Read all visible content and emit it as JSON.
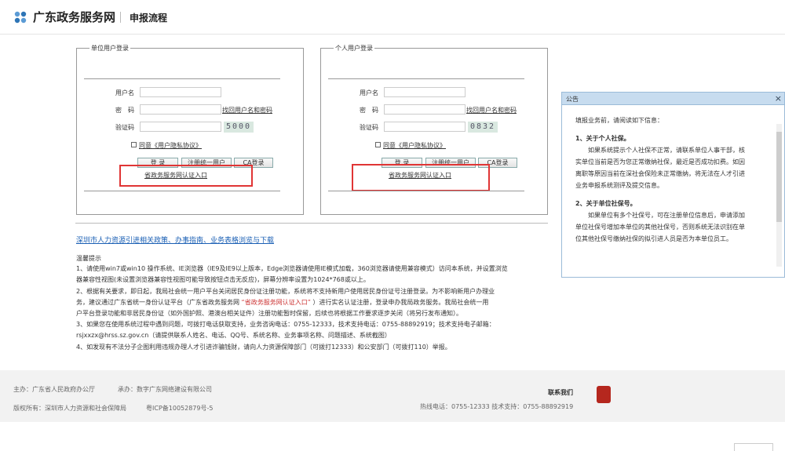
{
  "header": {
    "site_name": "广东政务服务网",
    "page_title": "申报流程"
  },
  "unit_login": {
    "legend": "单位用户登录",
    "username_label": "用户名",
    "password_label": "密　码",
    "forgot_link": "找回用户名和密码",
    "captcha_label": "验证码",
    "captcha_text": "5000",
    "agree_text": "同意《用户隐私协议》",
    "login_button": "登 录",
    "register_button": "注册统一用户",
    "ca_button": "CA登录",
    "gov_auth_link": "省政务服务网认证入口"
  },
  "personal_login": {
    "legend": "个人用户登录",
    "username_label": "用户名",
    "password_label": "密　码",
    "forgot_link": "找回用户名和密码",
    "captcha_label": "验证码",
    "captcha_text": "0832",
    "agree_text": "同意《用户隐私协议》",
    "login_button": "登 录",
    "register_button": "注册统一用户",
    "ca_button": "CA登录",
    "gov_auth_link": "省政务服务网认证入口"
  },
  "download_link": "深圳市人力资源引进相关政策、办事指南、业务表格浏览与下载",
  "tips": {
    "title": "温馨提示",
    "lines": [
      "1、请使用win7或win10 操作系统、IE浏览器（IE9及IE9以上版本，Edge浏览器请使用IE模式加载，360浏览器请使用兼容模式）访问本系统，并设置浏览",
      "器兼容性视图(未设置浏览器兼容性视图可能导致按钮点击无反应)，屏幕分辨率设置为1024*768或以上。",
      "2、根据有关要求，即日起，我局社会统一用户平台关闭居民身份证注册功能，系统将不支持新用户使用居民身份证号注册登录。为不影响新用户办理业",
      "务，建议通过广东省统一身份认证平台（广东省政务服务网",
      "“省政务服务网认证入口”",
      "）进行实名认证注册，登录申办我局政务服务。我局社会统一用",
      "户平台登录功能和非居民身份证（如外国护照、港澳台相关证件）注册功能暂时保留，后续也将根据工作要求逐步关闭（将另行发布通知）。",
      "3、如果您在使用系统过程中遇到问题，可拨打电话获取支持，业务咨询电话：0755-12333，技术支持电话：0755-88892919；技术支持电子邮箱：",
      "rsjxxzx@hrss.sz.gov.cn（请提供联系人姓名、电话、QQ号、系统名称、业务事项名称、问题描述、系统截图）",
      "4、如发现有不法分子企图利用违规办理人才引进诈骗钱财，请向人力资源保障部门（可拨打12333）和公安部门（可拨打110）举报。"
    ]
  },
  "notice": {
    "title": "公告",
    "close": "×",
    "intro": "填报业务前，请阅读如下信息：",
    "s1_title": "1、关于个人社保。",
    "s1_lines": [
      "如果系统提示个人社保不正常，请联系单位人事干部，核",
      "实单位当前是否为您正常缴纳社保，最近是否成功扣费。如因",
      "离职等原因当前在深社会保险未正常缴纳，将无法在人才引进",
      "业务申报系统测评及提交信息。"
    ],
    "s2_title": "2、关于单位社保号。",
    "s2_lines": [
      "如果单位有多个社保号，可在注册单位信息后，申请添加",
      "单位社保号增加本单位的其他社保号，否则系统无法识别在单",
      "位其他社保号缴纳社保的拟引进人员是否为本单位员工。"
    ]
  },
  "footer": {
    "sponsor": "主办：广东省人民政府办公厅",
    "undertaker": "承办：数字广东网络建设有限公司",
    "copyright": "版权所有：深圳市人力资源和社会保障局",
    "icp": "粤ICP备10052879号-5",
    "contact": "联系我们",
    "hotline": "热线电话：0755-12333 技术支持：0755-88892919"
  }
}
